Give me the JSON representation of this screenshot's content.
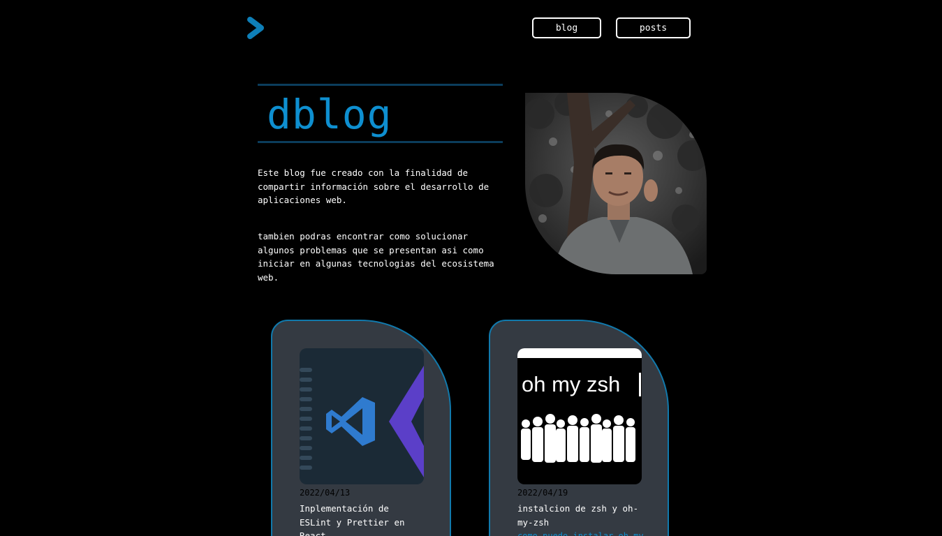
{
  "header": {
    "logo_icon": "chevron-right-icon",
    "nav": [
      {
        "label": "blog"
      },
      {
        "label": "posts"
      }
    ]
  },
  "hero": {
    "title": "dblog",
    "paragraphs": [
      "Este blog fue creado con la finalidad de compartir información sobre el desarrollo de aplicaciones web.",
      "tambien podras encontrar como solucionar algunos problemas que se presentan asi como iniciar en algunas tecnologias del ecosistema web."
    ]
  },
  "posts": [
    {
      "date": "2022/04/13",
      "title": "Inplementación de ESLint y Prettier en React",
      "image": "vscode-logo"
    },
    {
      "date": "2022/04/19",
      "title": "instalcion de zsh y oh-my-zsh",
      "image_text": "oh my zsh",
      "link": "como puedo instalar oh-my-zsh"
    }
  ],
  "colors": {
    "accent": "#0e8fd0",
    "card_bg": "#343a42",
    "card_border": "#1179ac",
    "background": "#000000"
  }
}
